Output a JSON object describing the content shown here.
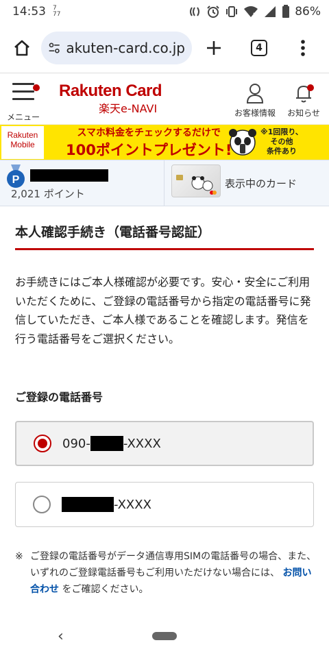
{
  "status_bar": {
    "time": "14:53",
    "net_up": "7",
    "net_down": "77",
    "battery": "86%"
  },
  "browser": {
    "url": "akuten-card.co.jp",
    "tab_count": "4"
  },
  "header": {
    "menu_label": "メニュー",
    "logo_main": "Rakuten Card",
    "logo_sub": "楽天e-NAVI",
    "account_label": "お客様情報",
    "notice_label": "お知らせ"
  },
  "banner": {
    "logo_line1": "Rakuten",
    "logo_line2": "Mobile",
    "line1": "スマホ料金をチェックするだけで",
    "line2": "100ポイントプレゼント!",
    "note_line1": "※1回限り、",
    "note_line2": "その他",
    "note_line3": "条件あり"
  },
  "points": {
    "value": "2,021 ポイント",
    "card_label": "表示中のカード"
  },
  "content": {
    "title": "本人確認手続き（電話番号認証）",
    "description": "お手続きにはご本人様確認が必要です。安心・安全にご利用いただくために、ご登録の電話番号から指定の電話番号に発信していただき、ご本人様であることを確認します。発信を行う電話番号をご選択ください。",
    "phone_section_title": "ご登録の電話番号",
    "options": [
      {
        "prefix": "090-",
        "suffix": "-XXXX",
        "selected": true
      },
      {
        "prefix": "",
        "suffix": "-XXXX",
        "selected": false
      }
    ],
    "note_mark": "※",
    "note_before": "ご登録の電話番号がデータ通信専用SIMの電話番号の場合、また、いずれのご登録電話番号もご利用いただけない場合には、",
    "note_link": "お問い合わせ",
    "note_after": "をご確認ください。"
  },
  "nav": {
    "back_glyph": "‹"
  },
  "colors": {
    "brand_red": "#bf0000",
    "banner_yellow": "#ffe400",
    "link_blue": "#0050a8"
  }
}
